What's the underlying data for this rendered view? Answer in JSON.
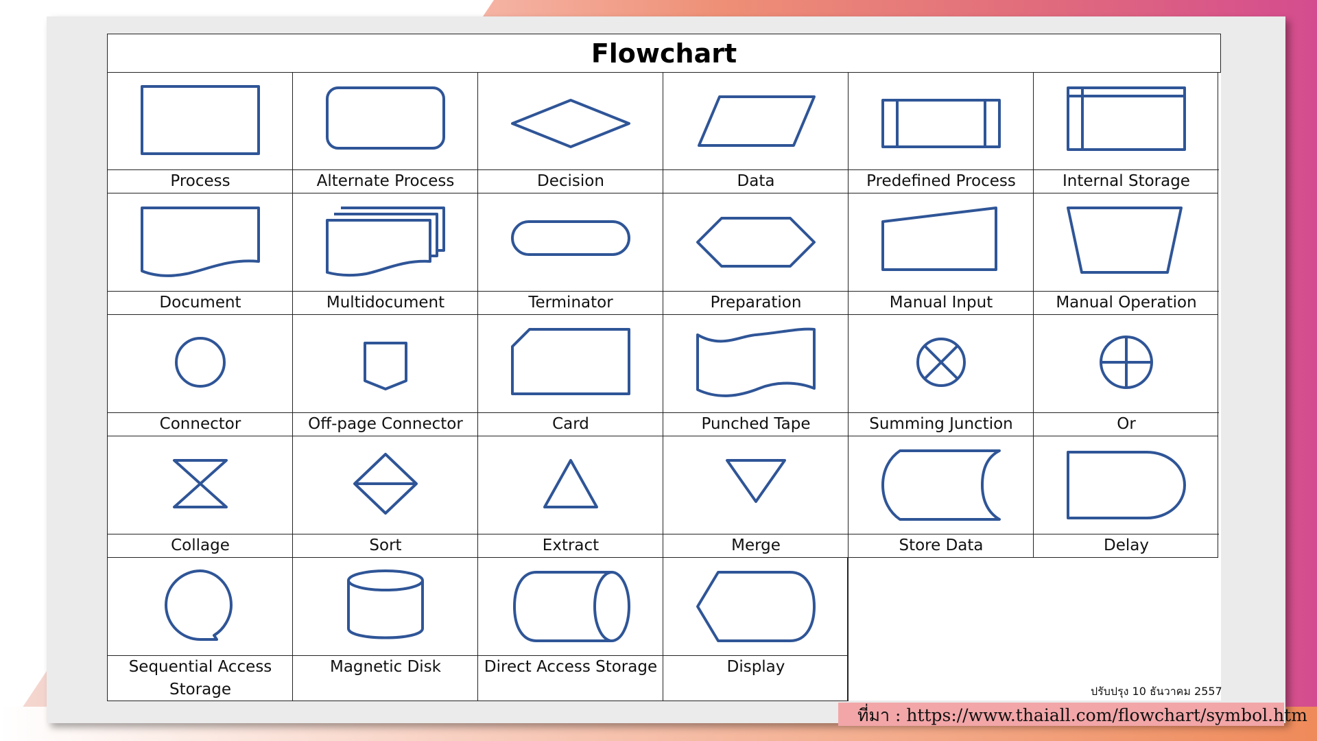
{
  "title": "Flowchart",
  "symbols": [
    {
      "label": "Process",
      "icon": "process-icon"
    },
    {
      "label": "Alternate Process",
      "icon": "alternate-process-icon"
    },
    {
      "label": "Decision",
      "icon": "decision-icon"
    },
    {
      "label": "Data",
      "icon": "data-icon"
    },
    {
      "label": "Predefined Process",
      "icon": "predefined-process-icon"
    },
    {
      "label": "Internal Storage",
      "icon": "internal-storage-icon"
    },
    {
      "label": "Document",
      "icon": "document-icon"
    },
    {
      "label": "Multidocument",
      "icon": "multidocument-icon"
    },
    {
      "label": "Terminator",
      "icon": "terminator-icon"
    },
    {
      "label": "Preparation",
      "icon": "preparation-icon"
    },
    {
      "label": "Manual Input",
      "icon": "manual-input-icon"
    },
    {
      "label": "Manual Operation",
      "icon": "manual-operation-icon"
    },
    {
      "label": "Connector",
      "icon": "connector-icon"
    },
    {
      "label": "Off-page Connector",
      "icon": "off-page-connector-icon"
    },
    {
      "label": "Card",
      "icon": "card-icon"
    },
    {
      "label": "Punched Tape",
      "icon": "punched-tape-icon"
    },
    {
      "label": "Summing Junction",
      "icon": "summing-junction-icon"
    },
    {
      "label": "Or",
      "icon": "or-icon"
    },
    {
      "label": "Collage",
      "icon": "collage-icon"
    },
    {
      "label": "Sort",
      "icon": "sort-icon"
    },
    {
      "label": "Extract",
      "icon": "extract-icon"
    },
    {
      "label": "Merge",
      "icon": "merge-icon"
    },
    {
      "label": "Store Data",
      "icon": "store-data-icon"
    },
    {
      "label": "Delay",
      "icon": "delay-icon"
    },
    {
      "label": "Sequential Access Storage",
      "icon": "sequential-access-storage-icon"
    },
    {
      "label": "Magnetic Disk",
      "icon": "magnetic-disk-icon"
    },
    {
      "label": "Direct Access Storage",
      "icon": "direct-access-storage-icon"
    },
    {
      "label": "Display",
      "icon": "display-icon"
    }
  ],
  "footer": {
    "update_note": "ปรับปรุง 10 ธันวาคม 2557",
    "source": "ที่มา : https://www.thaiall.com/flowchart/symbol.htm"
  },
  "colors": {
    "shape_stroke": "#2f5597",
    "grid_line": "#222222"
  }
}
